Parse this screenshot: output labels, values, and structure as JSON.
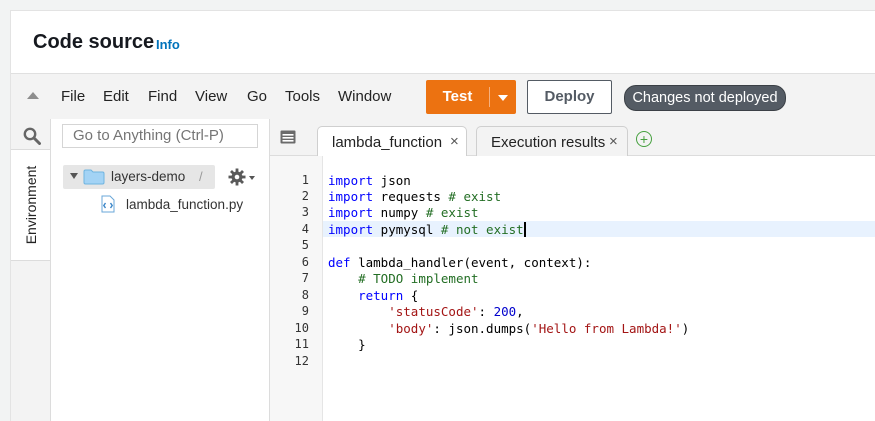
{
  "header": {
    "title": "Code source",
    "info": "Info"
  },
  "menu": [
    "File",
    "Edit",
    "Find",
    "View",
    "Go",
    "Tools",
    "Window"
  ],
  "buttons": {
    "test": "Test",
    "deploy": "Deploy"
  },
  "status_badge": "Changes not deployed",
  "sidebar": {
    "rail_tab": "Environment"
  },
  "files": {
    "search_placeholder": "Go to Anything (Ctrl-P)",
    "folder": "layers-demo",
    "folder_suffix": "/",
    "file": "lambda_function.py"
  },
  "tabs": [
    {
      "label": "lambda_function",
      "close": "×"
    },
    {
      "label": "Execution results",
      "close": "×"
    }
  ],
  "tab_add": "+",
  "editor": {
    "line_numbers": [
      "1",
      "2",
      "3",
      "4",
      "5",
      "6",
      "7",
      "8",
      "9",
      "10",
      "11",
      "12"
    ],
    "lines": [
      "import json",
      "import requests # exist",
      "import numpy # exist",
      "import pymysql # not exist",
      "",
      "def lambda_handler(event, context):",
      "    # TODO implement",
      "    return {",
      "        'statusCode': 200,",
      "        'body': json.dumps('Hello from Lambda!')",
      "    }",
      ""
    ]
  },
  "colors": {
    "accent_orange": "#ec7211",
    "link_blue": "#0073bb",
    "keyword_blue": "#0000ff",
    "comment_green": "#236e24",
    "string_red": "#a31515",
    "badge_gray": "#545b64"
  },
  "icons": {
    "collapse": "collapse-triangle-icon",
    "search": "search-icon",
    "folder": "folder-icon",
    "file": "python-file-icon",
    "gear": "gear-icon",
    "tabs": "tabs-icon",
    "add": "add-tab-icon"
  }
}
